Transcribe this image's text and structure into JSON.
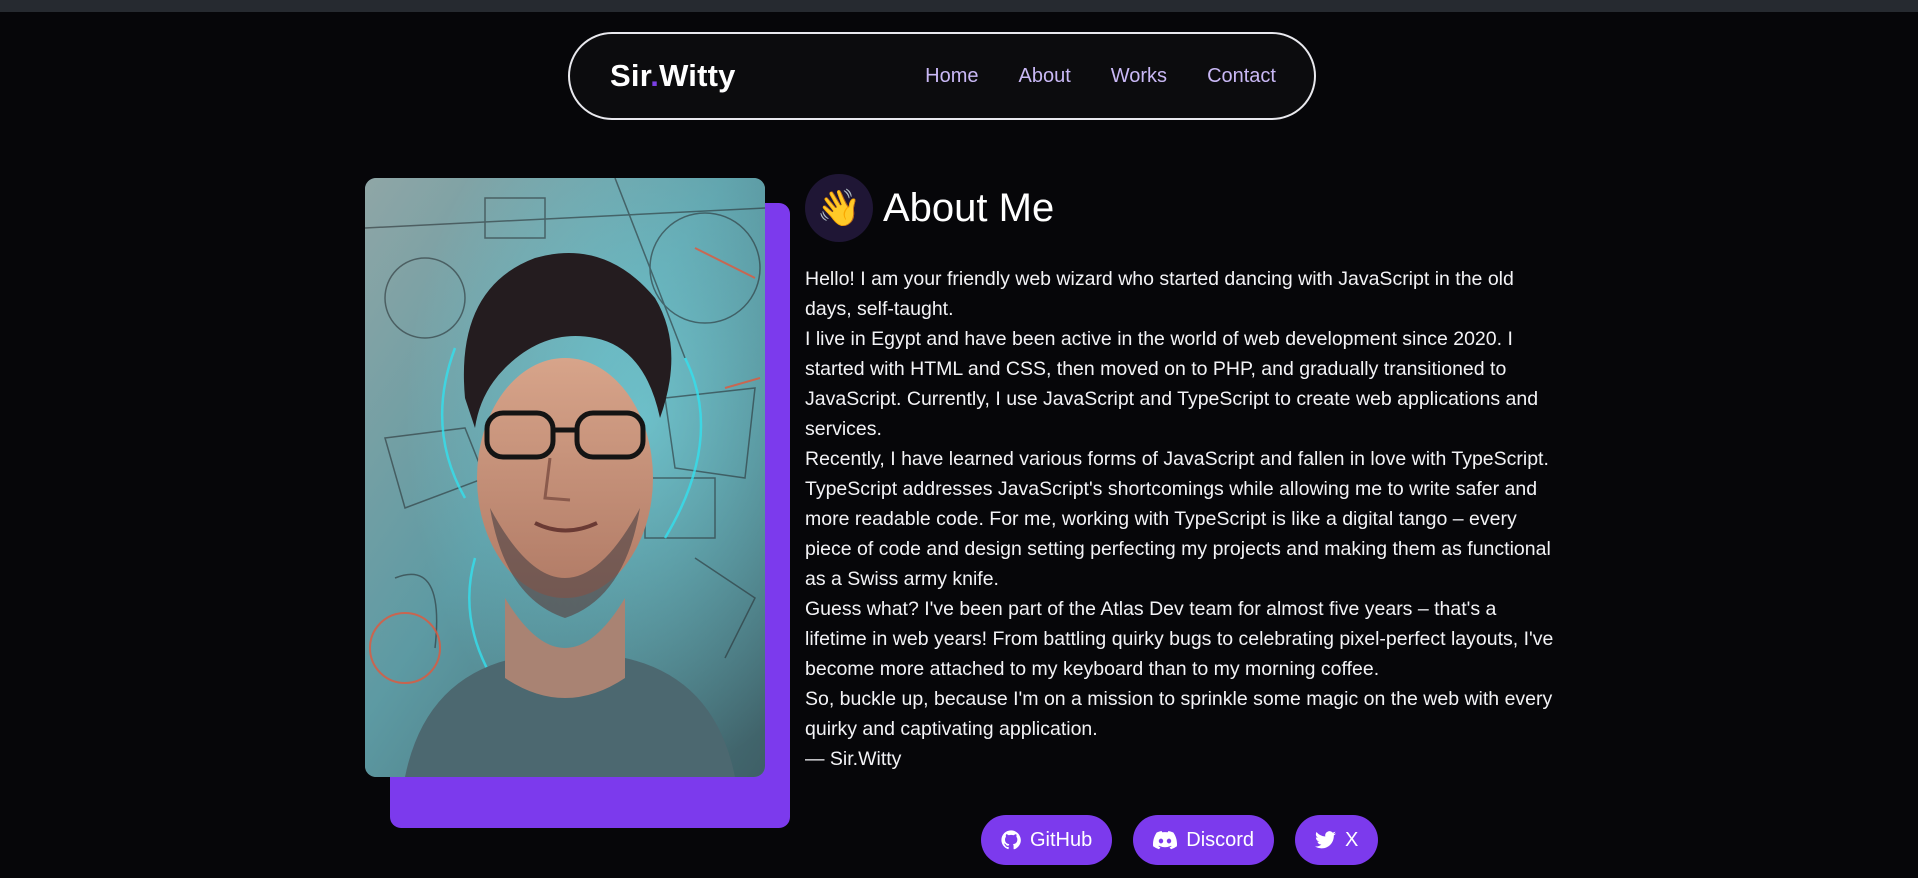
{
  "nav": {
    "brand_part1": "Sir",
    "brand_dot": ".",
    "brand_part2": "Witty",
    "links": [
      "Home",
      "About",
      "Works",
      "Contact"
    ]
  },
  "about": {
    "emoji": "👋",
    "title": "About Me",
    "paragraphs": [
      "Hello! I am your friendly web wizard who started dancing with JavaScript in the old days, self-taught.",
      "I live in Egypt and have been active in the world of web development since 2020. I started with HTML and CSS, then moved on to PHP, and gradually transitioned to JavaScript. Currently, I use JavaScript and TypeScript to create web applications and services.",
      "Recently, I have learned various forms of JavaScript and fallen in love with TypeScript. TypeScript addresses JavaScript's shortcomings while allowing me to write safer and more readable code. For me, working with TypeScript is like a digital tango – every piece of code and design setting perfecting my projects and making them as functional as a Swiss army knife.",
      "Guess what? I've been part of the Atlas Dev team for almost five years – that's a lifetime in web years! From battling quirky bugs to celebrating pixel-perfect layouts, I've become more attached to my keyboard than to my morning coffee.",
      "So, buckle up, because I'm on a mission to sprinkle some magic on the web with every quirky and captivating application.",
      "— Sir.Witty"
    ]
  },
  "socials": [
    {
      "label": "GitHub",
      "icon": "github-icon"
    },
    {
      "label": "Discord",
      "icon": "discord-icon"
    },
    {
      "label": "X",
      "icon": "twitter-bird-icon"
    }
  ],
  "colors": {
    "accent": "#7c3aed",
    "background": "#060609",
    "nav_link": "#c9b8f5"
  }
}
